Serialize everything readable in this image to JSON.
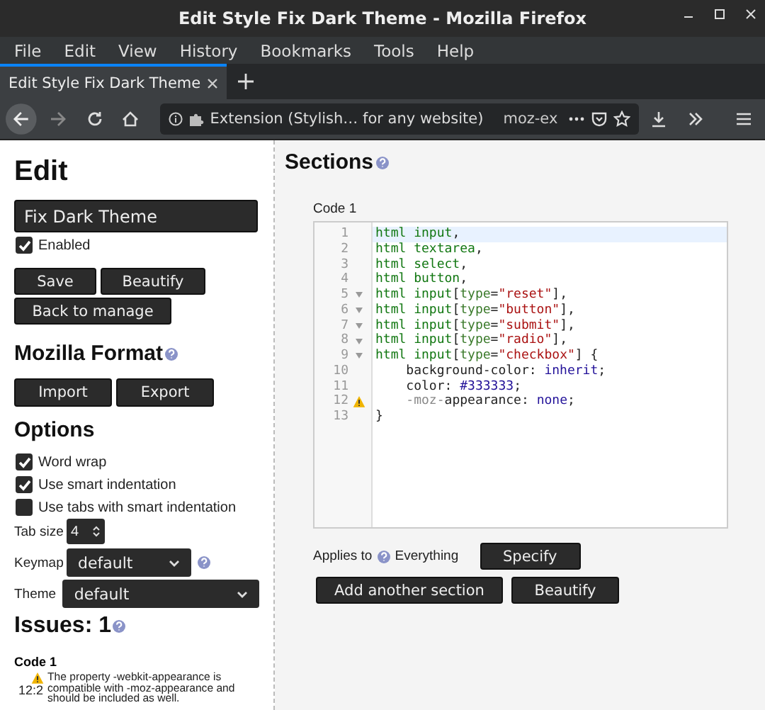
{
  "window": {
    "title": "Edit Style Fix Dark Theme - Mozilla Firefox"
  },
  "menu": [
    "File",
    "Edit",
    "View",
    "History",
    "Bookmarks",
    "Tools",
    "Help"
  ],
  "tabs": [
    {
      "label": "Edit Style Fix Dark Theme",
      "selected": true
    }
  ],
  "address_bar": {
    "identity": "Extension (Stylish… for any website)",
    "url": "moz-ex"
  },
  "sidebar": {
    "heading": "Edit",
    "name_value": "Fix Dark Theme",
    "enabled": {
      "label": "Enabled",
      "checked": true
    },
    "buttons": [
      "Save",
      "Beautify",
      "Back to manage"
    ],
    "format": {
      "heading": "Mozilla Format",
      "buttons": [
        "Import",
        "Export"
      ]
    },
    "options": {
      "heading": "Options",
      "checkboxes": [
        {
          "label": "Word wrap",
          "checked": true
        },
        {
          "label": "Use smart indentation",
          "checked": true
        },
        {
          "label": "Use tabs with smart indentation",
          "checked": false
        }
      ],
      "tab_size": {
        "label": "Tab size",
        "value": "4"
      },
      "keymap": {
        "label": "Keymap",
        "value": "default"
      },
      "theme": {
        "label": "Theme",
        "value": "default"
      }
    },
    "issues": {
      "heading": "Issues: 1",
      "section": "Code 1",
      "items": [
        {
          "location": "12:2",
          "message": "The property -webkit-appearance is compatible with -moz-appearance and should be included as well."
        }
      ]
    }
  },
  "sections": {
    "heading": "Sections",
    "code_label": "Code 1",
    "lines": [
      {
        "number": "1",
        "active": true,
        "foldable": false,
        "warning": false,
        "tokens": [
          {
            "text": "html input",
            "kind": "tag"
          },
          {
            "text": ",",
            "kind": "punct"
          }
        ]
      },
      {
        "number": "2",
        "active": false,
        "foldable": false,
        "warning": false,
        "tokens": [
          {
            "text": "html textarea",
            "kind": "tag"
          },
          {
            "text": ",",
            "kind": "punct"
          }
        ]
      },
      {
        "number": "3",
        "active": false,
        "foldable": false,
        "warning": false,
        "tokens": [
          {
            "text": "html select",
            "kind": "tag"
          },
          {
            "text": ",",
            "kind": "punct"
          }
        ]
      },
      {
        "number": "4",
        "active": false,
        "foldable": false,
        "warning": false,
        "tokens": [
          {
            "text": "html button",
            "kind": "tag"
          },
          {
            "text": ",",
            "kind": "punct"
          }
        ]
      },
      {
        "number": "5",
        "active": false,
        "foldable": true,
        "warning": false,
        "tokens": [
          {
            "text": "html input",
            "kind": "tag"
          },
          {
            "text": "[",
            "kind": "punct"
          },
          {
            "text": "type",
            "kind": "attr"
          },
          {
            "text": "=",
            "kind": "punct"
          },
          {
            "text": "\"reset\"",
            "kind": "string"
          },
          {
            "text": "],",
            "kind": "punct"
          }
        ]
      },
      {
        "number": "6",
        "active": false,
        "foldable": true,
        "warning": false,
        "tokens": [
          {
            "text": "html input",
            "kind": "tag"
          },
          {
            "text": "[",
            "kind": "punct"
          },
          {
            "text": "type",
            "kind": "attr"
          },
          {
            "text": "=",
            "kind": "punct"
          },
          {
            "text": "\"button\"",
            "kind": "string"
          },
          {
            "text": "],",
            "kind": "punct"
          }
        ]
      },
      {
        "number": "7",
        "active": false,
        "foldable": true,
        "warning": false,
        "tokens": [
          {
            "text": "html input",
            "kind": "tag"
          },
          {
            "text": "[",
            "kind": "punct"
          },
          {
            "text": "type",
            "kind": "attr"
          },
          {
            "text": "=",
            "kind": "punct"
          },
          {
            "text": "\"submit\"",
            "kind": "string"
          },
          {
            "text": "],",
            "kind": "punct"
          }
        ]
      },
      {
        "number": "8",
        "active": false,
        "foldable": true,
        "warning": false,
        "tokens": [
          {
            "text": "html input",
            "kind": "tag"
          },
          {
            "text": "[",
            "kind": "punct"
          },
          {
            "text": "type",
            "kind": "attr"
          },
          {
            "text": "=",
            "kind": "punct"
          },
          {
            "text": "\"radio\"",
            "kind": "string"
          },
          {
            "text": "],",
            "kind": "punct"
          }
        ]
      },
      {
        "number": "9",
        "active": false,
        "foldable": true,
        "warning": false,
        "tokens": [
          {
            "text": "html input",
            "kind": "tag"
          },
          {
            "text": "[",
            "kind": "punct"
          },
          {
            "text": "type",
            "kind": "attr"
          },
          {
            "text": "=",
            "kind": "punct"
          },
          {
            "text": "\"checkbox\"",
            "kind": "string"
          },
          {
            "text": "] {",
            "kind": "punct"
          }
        ]
      },
      {
        "number": "10",
        "active": false,
        "foldable": false,
        "warning": false,
        "tokens": [
          {
            "text": "    background-color",
            "kind": "prop"
          },
          {
            "text": ": ",
            "kind": "punct"
          },
          {
            "text": "inherit",
            "kind": "atom"
          },
          {
            "text": ";",
            "kind": "punct"
          }
        ]
      },
      {
        "number": "11",
        "active": false,
        "foldable": false,
        "warning": false,
        "tokens": [
          {
            "text": "    color",
            "kind": "prop"
          },
          {
            "text": ": ",
            "kind": "punct"
          },
          {
            "text": "#333333",
            "kind": "atom"
          },
          {
            "text": ";",
            "kind": "punct"
          }
        ]
      },
      {
        "number": "12",
        "active": false,
        "foldable": false,
        "warning": true,
        "tokens": [
          {
            "text": "    -moz-",
            "kind": "vendor"
          },
          {
            "text": "appearance",
            "kind": "prop"
          },
          {
            "text": ": ",
            "kind": "punct"
          },
          {
            "text": "none",
            "kind": "atom"
          },
          {
            "text": ";",
            "kind": "punct"
          }
        ]
      },
      {
        "number": "13",
        "active": false,
        "foldable": false,
        "warning": false,
        "tokens": [
          {
            "text": "}",
            "kind": "punct"
          }
        ]
      }
    ],
    "applies_label": "Applies to",
    "applies_value": "Everything",
    "specify_button": "Specify",
    "buttons": [
      "Add another section",
      "Beautify"
    ]
  }
}
